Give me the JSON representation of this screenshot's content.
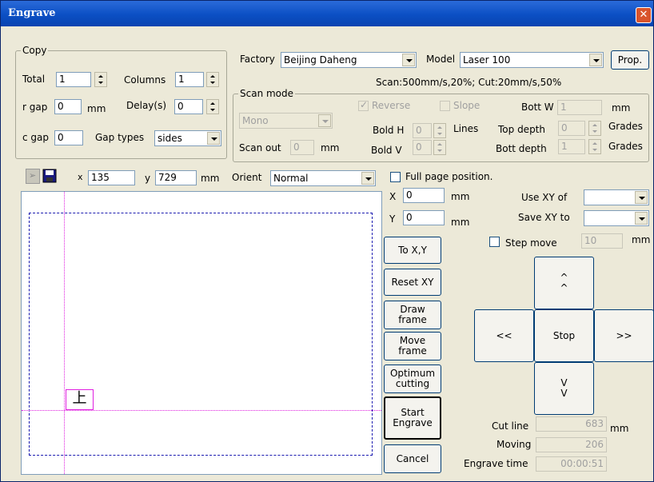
{
  "window": {
    "title": "Engrave"
  },
  "copy": {
    "group_label": "Copy",
    "total_label": "Total",
    "total_value": "1",
    "columns_label": "Columns",
    "columns_value": "1",
    "rgap_label": "r gap",
    "rgap_value": "0",
    "rgap_unit": "mm",
    "delay_label": "Delay(s)",
    "delay_value": "0",
    "cgap_label": "c gap",
    "cgap_value": "0",
    "gaptypes_label": "Gap types",
    "gaptypes_value": "sides"
  },
  "device": {
    "factory_label": "Factory",
    "factory_value": "Beijing Daheng",
    "model_label": "Model",
    "model_value": "Laser 100",
    "prop_label": "Prop.",
    "scan_info": "Scan:500mm/s,20%; Cut:20mm/s,50%"
  },
  "scan": {
    "group_label": "Scan mode",
    "mode_value": "Mono",
    "scanout_label": "Scan out",
    "scanout_value": "0",
    "scanout_unit": "mm",
    "reverse_label": "Reverse",
    "slope_label": "Slope",
    "bolth_label": "Bold H",
    "bolth_value": "0",
    "boldv_label": "Bold V",
    "boldv_value": "0",
    "lines_label": "Lines",
    "bottw_label": "Bott W",
    "bottw_value": "1",
    "bottw_unit": "mm",
    "topdepth_label": "Top depth",
    "topdepth_value": "0",
    "topdepth_unit": "Grades",
    "bottdepth_label": "Bott depth",
    "bottdepth_value": "1",
    "bottdepth_unit": "Grades"
  },
  "toolbar": {
    "x_label": "x",
    "x_value": "135",
    "y_label": "y",
    "y_value": "729",
    "unit": "mm",
    "orient_label": "Orient",
    "orient_value": "Normal"
  },
  "canvas": {
    "glyph": "上"
  },
  "position": {
    "fullpage_label": "Full page position.",
    "x_label": "X",
    "x_value": "0",
    "x_unit": "mm",
    "y_label": "Y",
    "y_value": "0",
    "y_unit": "mm",
    "usexy_label": "Use XY of",
    "usexy_value": "",
    "savexy_label": "Save XY to",
    "savexy_value": "",
    "stepmove_label": "Step move",
    "stepmove_value": "10",
    "stepmove_unit": "mm"
  },
  "buttons": {
    "to_xy": "To X,Y",
    "reset_xy": "Reset XY",
    "draw_frame": "Draw\nframe",
    "move_frame": "Move\nframe",
    "optimum": "Optimum\ncutting",
    "start": "Start\nEngrave",
    "cancel": "Cancel"
  },
  "nav": {
    "up": "^\n^",
    "left": "<<",
    "stop": "Stop",
    "right": ">>",
    "down": "V\nV"
  },
  "stats": {
    "cutline_label": "Cut line",
    "cutline_value": "683",
    "cutline_unit": "mm",
    "moving_label": "Moving",
    "moving_value": "206",
    "time_label": "Engrave time",
    "time_value": "00:00:51"
  },
  "colors": {
    "title_bar": "#0b4fc4",
    "dashed_frame": "#1a1ab0",
    "guide_line": "#e020e0"
  }
}
